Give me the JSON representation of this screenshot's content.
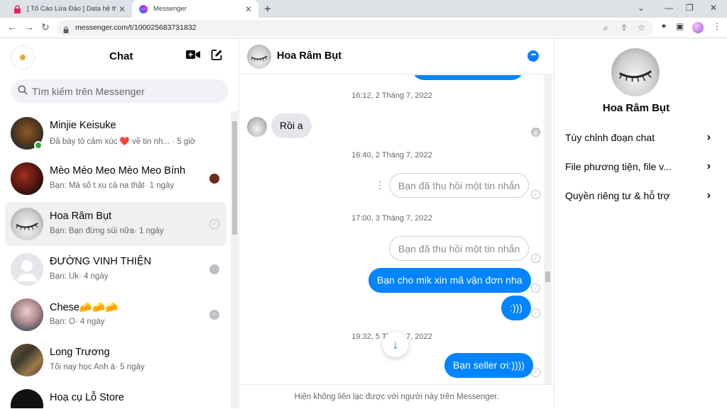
{
  "browser": {
    "tabs": [
      {
        "title": "[ Tố Cáo Lừa Đảo ] Data hệ thống",
        "active": false,
        "icon": "lock-icon"
      },
      {
        "title": "Messenger",
        "active": true,
        "icon": "messenger-icon"
      }
    ],
    "url": "messenger.com/t/100025683731832"
  },
  "sidebar": {
    "title": "Chat",
    "search_placeholder": "Tìm kiếm trên Messenger",
    "conversations": [
      {
        "name": "Minjie Keisuke",
        "preview": "Đã bày tỏ cảm xúc ❤️ về tin nh...",
        "time": "· 5 giờ",
        "online": true,
        "selected": false
      },
      {
        "name": "Mèo Méo Meo Mèo Meo Bính",
        "preview": "Bạn: Mà số t xu cà na thật",
        "time": "· 1 ngày",
        "online": false,
        "selected": false
      },
      {
        "name": "Hoa Râm Bụt",
        "preview": "Bạn: Bạn đừng sủi nữa",
        "time": "· 1 ngày",
        "online": false,
        "selected": true
      },
      {
        "name": "ĐƯỜNG VINH THIỆN",
        "preview": "Bạn: Uk",
        "time": "· 4 ngày",
        "online": false,
        "selected": false
      },
      {
        "name": "Chese🧀🧀🧀",
        "preview": "Bạn: Ò",
        "time": "· 4 ngày",
        "online": false,
        "selected": false
      },
      {
        "name": "Long Trương",
        "preview": "Tối nay học Anh à",
        "time": "· 5 ngày",
        "online": false,
        "selected": false
      },
      {
        "name": "Hoạ cụ Lỗ Store",
        "preview": "",
        "time": "",
        "online": false,
        "selected": false
      }
    ]
  },
  "chat": {
    "contact_name": "Hoa Râm Bụt",
    "timestamps": [
      "16:12, 2 Tháng 7, 2022",
      "16:40, 2 Tháng 7, 2022",
      "17:00, 3 Tháng 7, 2022",
      "19:32, 5 Tháng 7, 2022"
    ],
    "messages": [
      {
        "text": "Rồi a",
        "kind": "in"
      },
      {
        "text": "Bạn đã thu hồi một tin nhắn",
        "kind": "recalled"
      },
      {
        "text": "Bạn đã thu hồi một tin nhắn",
        "kind": "recalled"
      },
      {
        "text": "Bạn cho mik xin mã vận đơn nha",
        "kind": "out"
      },
      {
        "text": ":)))",
        "kind": "out"
      },
      {
        "text": "Bạn seller ơi:))))",
        "kind": "out"
      }
    ],
    "footer_notice": "Hiện không liên lạc được với người này trên Messenger."
  },
  "info_panel": {
    "name": "Hoa Râm Bụt",
    "items": [
      {
        "label": "Tùy chỉnh đoạn chat"
      },
      {
        "label": "File phương tiện, file v..."
      },
      {
        "label": "Quyền riêng tư & hỗ trợ"
      }
    ]
  },
  "colors": {
    "accent": "#0084ff",
    "online": "#31a24c"
  }
}
